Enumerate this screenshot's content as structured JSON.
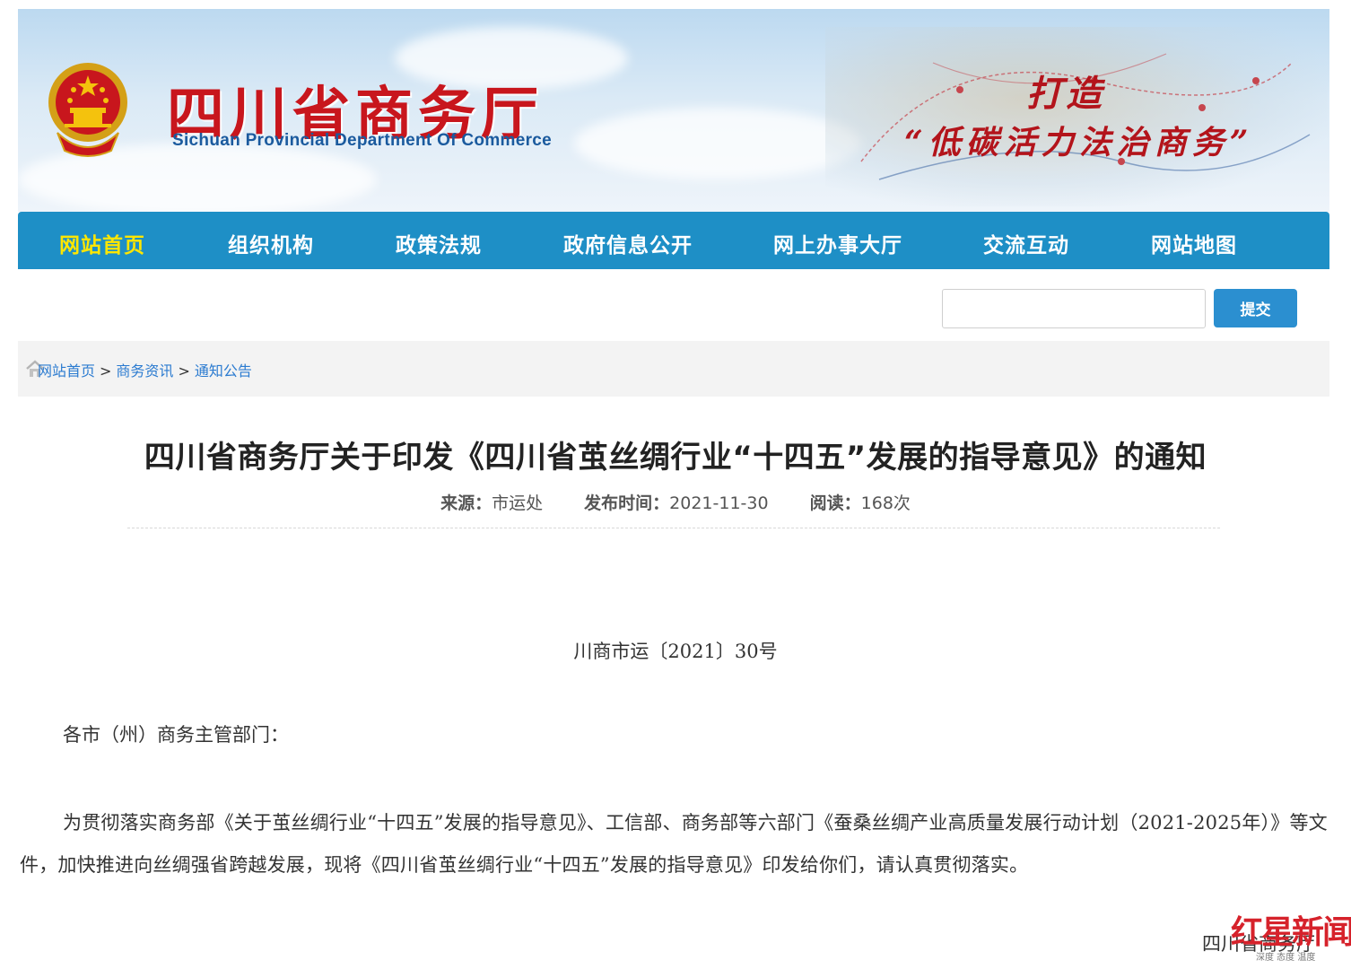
{
  "header": {
    "site_title": "四川省商务厅",
    "site_title_en": "Sichuan Provincial Department Of Commerce",
    "slogan_line1": "打造",
    "slogan_line2": "“低碳活力法治商务”"
  },
  "nav": {
    "items": [
      {
        "label": "网站首页",
        "active": true
      },
      {
        "label": "组织机构"
      },
      {
        "label": "政策法规"
      },
      {
        "label": "政府信息公开"
      },
      {
        "label": "网上办事大厅"
      },
      {
        "label": "交流互动"
      },
      {
        "label": "网站地图"
      }
    ]
  },
  "search": {
    "value": "",
    "submit_label": "提交"
  },
  "breadcrumb": {
    "items": [
      "网站首页",
      "商务资讯",
      "通知公告"
    ],
    "separator": ">"
  },
  "article": {
    "title": "四川省商务厅关于印发《四川省茧丝绸行业“十四五”发展的指导意见》的通知",
    "source_label": "来源：",
    "source": "市运处",
    "date_label": "发布时间：",
    "date": "2021-11-30",
    "views_label": "阅读：",
    "views": "168次",
    "doc_number": "川商市运〔2021〕30号",
    "salutation": "各市（州）商务主管部门：",
    "paragraph": "为贯彻落实商务部《关于茧丝绸行业“十四五”发展的指导意见》、工信部、商务部等六部门《蚕桑丝绸产业高质量发展行动计划（2021-2025年）》等文件，加快推进向丝绸强省跨越发展，现将《四川省茧丝绸行业“十四五”发展的指导意见》印发给你们，请认真贯彻落实。",
    "signature": "四川省商务厅"
  },
  "watermark": {
    "brand": "红星新闻",
    "tagline": "深度 态度 温度"
  },
  "colors": {
    "nav_bg": "#1e8fc6",
    "nav_active": "#ffe600",
    "title_red": "#c8161d",
    "link_blue": "#2b7bd0",
    "button_blue": "#2b8fd0"
  }
}
